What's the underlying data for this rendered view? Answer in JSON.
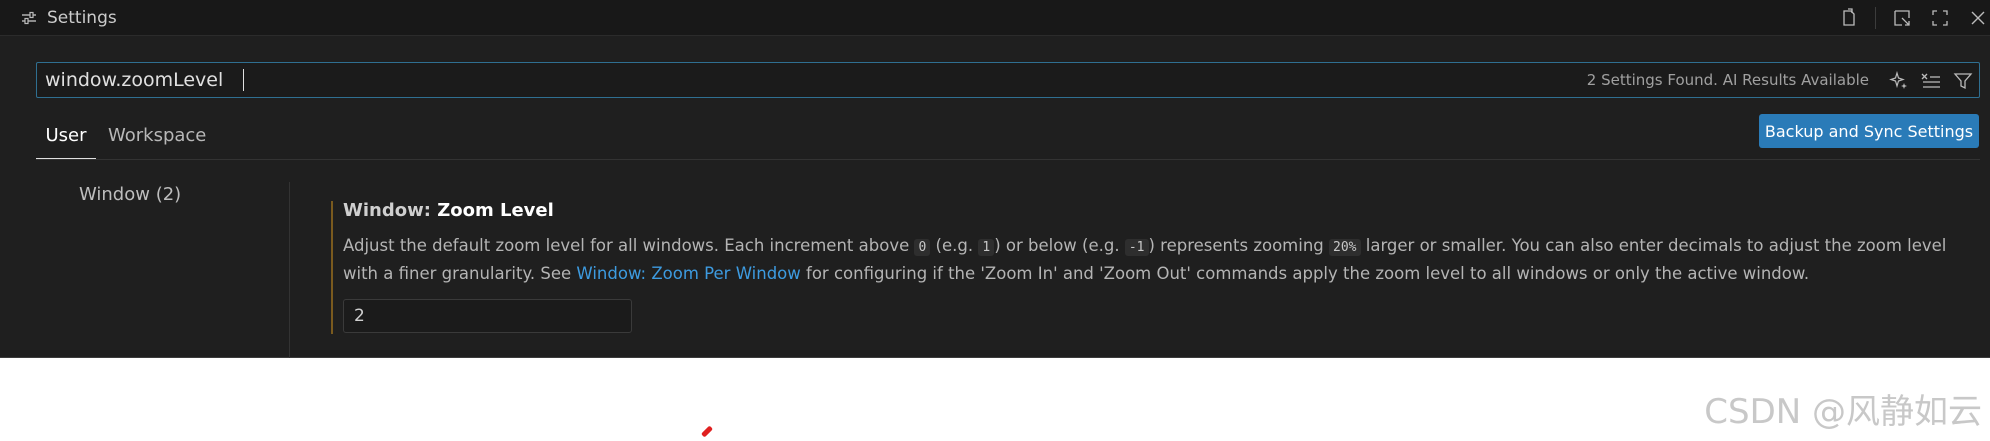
{
  "tab": {
    "title": "Settings",
    "icon": "settings-sliders-icon"
  },
  "tab_actions": [
    "open-settings-json-icon",
    "split-editor-icon",
    "maximize-icon",
    "close-icon"
  ],
  "search": {
    "value": "window.zoomLevel",
    "results": "2 Settings Found. AI Results Available",
    "actions": [
      "ai-sparkle-icon",
      "clear-filter-icon",
      "filter-icon"
    ]
  },
  "scopes": {
    "user": "User",
    "workspace": "Workspace",
    "active": "User"
  },
  "sync_button": "Backup and Sync Settings",
  "toc": {
    "item": "Window (2)"
  },
  "setting": {
    "category": "Window: ",
    "name": "Zoom Level",
    "desc_part1": "Adjust the default zoom level for all windows. Each increment above ",
    "code1": "0",
    "desc_part2": " (e.g. ",
    "code2": "1",
    "desc_part3": ") or below (e.g. ",
    "code3": "-1",
    "desc_part4": ") represents zooming ",
    "code4": "20%",
    "desc_part5": " larger or smaller. You can also enter decimals to adjust the zoom level with a finer granularity. See ",
    "link": "Window: Zoom Per Window",
    "desc_part6": " for configuring if the 'Zoom In' and 'Zoom Out' commands apply the zoom level to all windows or only the active window.",
    "value": "2"
  },
  "watermark": "CSDN @风静如云",
  "colors": {
    "accent": "#2a7bb8",
    "link": "#3d9be0",
    "modified_marker": "#7a5a1e",
    "background": "#1f1f1f"
  }
}
